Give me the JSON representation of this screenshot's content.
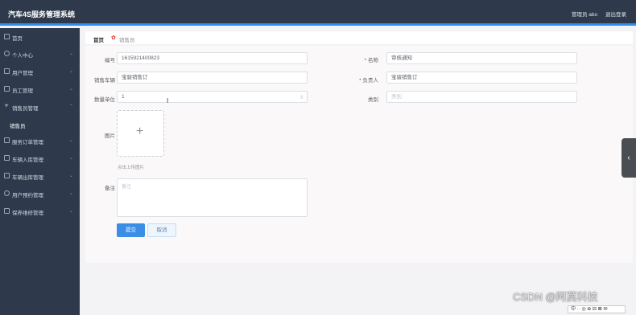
{
  "app": {
    "title": "汽车4S服务管理系统",
    "user": "管理员 abo",
    "logout": "退出登录"
  },
  "sidebar": {
    "items": [
      {
        "label": "首页",
        "icon": "home-icon"
      },
      {
        "label": "个人中心",
        "icon": "user-icon"
      },
      {
        "label": "用户管理",
        "icon": "list-icon"
      },
      {
        "label": "员工管理",
        "icon": "list-icon"
      },
      {
        "label": "销售员管理",
        "icon": "send-icon"
      },
      {
        "label": "销售员",
        "icon": ""
      },
      {
        "label": "服务订单管理",
        "icon": "order-icon"
      },
      {
        "label": "车辆入库管理",
        "icon": "car-icon"
      },
      {
        "label": "车辆出库管理",
        "icon": "car-icon"
      },
      {
        "label": "用户预约管理",
        "icon": "clock-icon"
      },
      {
        "label": "保养维修管理",
        "icon": "tool-icon"
      }
    ]
  },
  "breadcrumb": {
    "home": "首页",
    "current": "销售员"
  },
  "form": {
    "fields": {
      "number": {
        "label": "编号",
        "value": "1615921400823"
      },
      "name": {
        "label": "* 名称",
        "value": "审核通知"
      },
      "sales_car": {
        "label": "销售车辆",
        "value": "宝骏销售订"
      },
      "owner": {
        "label": "* 负责人",
        "value": "宝骏销售订"
      },
      "count": {
        "label": "数量单位",
        "value": "1"
      },
      "remark": {
        "label": "类别",
        "placeholder": "类别"
      },
      "image": {
        "label": "图片",
        "tip": "点击上传图片"
      },
      "note": {
        "label": "备注",
        "placeholder": "备注"
      }
    },
    "submit": "提交",
    "cancel": "取消"
  },
  "watermark": "CSDN @阿莫科技",
  "toolbar_strip": "中 ·· ◎ ⊕ ⊟ ⊠ ✉"
}
